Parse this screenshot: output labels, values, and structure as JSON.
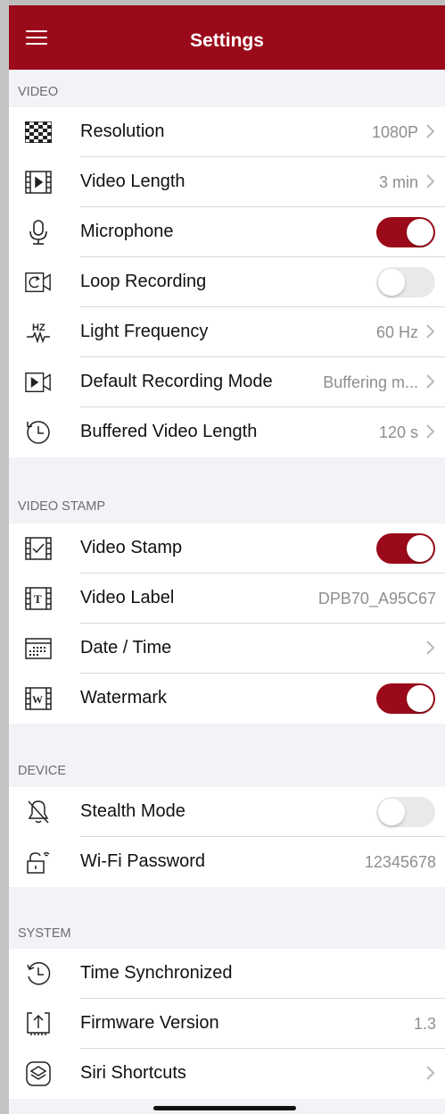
{
  "header": {
    "title": "Settings",
    "menu_icon": "hamburger-menu-icon"
  },
  "colors": {
    "brand": "#9b0a1a",
    "background": "#f2f2f7",
    "secondary_text": "#8e8e93"
  },
  "sections": [
    {
      "title": "VIDEO",
      "rows": [
        {
          "icon": "checkerboard-icon",
          "label": "Resolution",
          "value": "1080P",
          "chevron": true
        },
        {
          "icon": "film-play-icon",
          "label": "Video Length",
          "value": "3 min",
          "chevron": true
        },
        {
          "icon": "microphone-icon",
          "label": "Microphone",
          "toggle": true
        },
        {
          "icon": "loop-camera-icon",
          "label": "Loop Recording",
          "toggle": false
        },
        {
          "icon": "hz-wave-icon",
          "label": "Light Frequency",
          "value": "60 Hz",
          "chevron": true
        },
        {
          "icon": "record-mode-icon",
          "label": "Default Recording Mode",
          "value": "Buffering m...",
          "chevron": true
        },
        {
          "icon": "clock-history-icon",
          "label": "Buffered Video Length",
          "value": "120 s",
          "chevron": true
        }
      ]
    },
    {
      "title": "VIDEO STAMP",
      "rows": [
        {
          "icon": "film-check-icon",
          "label": "Video Stamp",
          "toggle": true
        },
        {
          "icon": "film-text-icon",
          "label": "Video Label",
          "value": "DPB70_A95C67",
          "chevron": false
        },
        {
          "icon": "calendar-icon",
          "label": "Date / Time",
          "value": "",
          "chevron": true
        },
        {
          "icon": "film-watermark-icon",
          "label": "Watermark",
          "toggle": true
        }
      ]
    },
    {
      "title": "DEVICE",
      "rows": [
        {
          "icon": "bell-slash-icon",
          "label": "Stealth Mode",
          "toggle": false
        },
        {
          "icon": "wifi-lock-icon",
          "label": "Wi-Fi Password",
          "value": "12345678",
          "chevron": false
        }
      ]
    },
    {
      "title": "SYSTEM",
      "rows": [
        {
          "icon": "clock-sync-icon",
          "label": "Time Synchronized"
        },
        {
          "icon": "firmware-upload-icon",
          "label": "Firmware Version",
          "value": "1.3",
          "chevron": false
        },
        {
          "icon": "siri-shortcuts-icon",
          "label": "Siri Shortcuts",
          "value": "",
          "chevron": true
        }
      ]
    }
  ]
}
